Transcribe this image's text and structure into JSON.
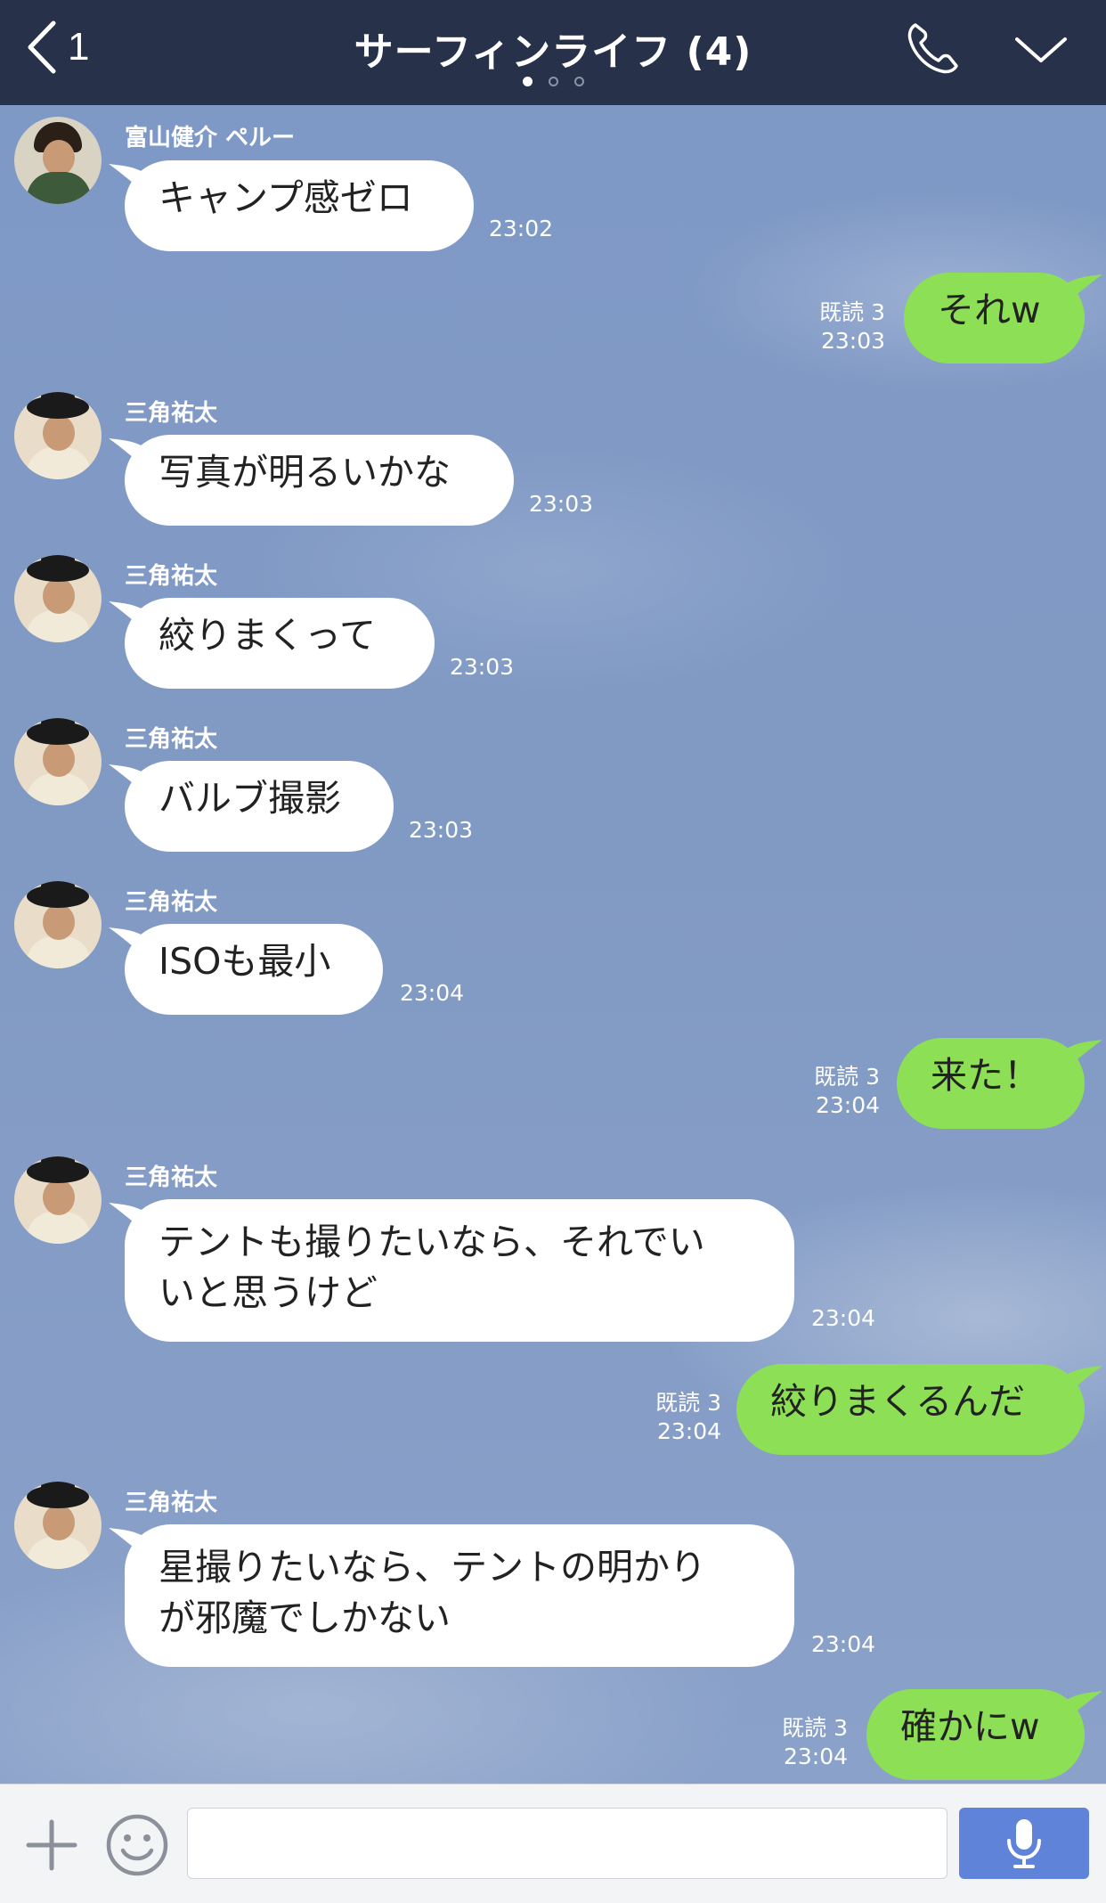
{
  "header": {
    "back_count": "1",
    "title": "サーフィンライフ (4)",
    "page_dots": 3,
    "active_dot": 0
  },
  "messages": [
    {
      "kind": "in",
      "sender": "富山健介 ペルー",
      "text": "キャンプ感ゼロ",
      "time": "23:02"
    },
    {
      "kind": "out",
      "read": "既読 3",
      "text": "それw",
      "time": "23:03"
    },
    {
      "kind": "in",
      "sender": "三角祐太",
      "text": "写真が明るいかな",
      "time": "23:03"
    },
    {
      "kind": "in",
      "sender": "三角祐太",
      "text": "絞りまくって",
      "time": "23:03"
    },
    {
      "kind": "in",
      "sender": "三角祐太",
      "text": "バルブ撮影",
      "time": "23:03"
    },
    {
      "kind": "in",
      "sender": "三角祐太",
      "text": "ISOも最小",
      "time": "23:04"
    },
    {
      "kind": "out",
      "read": "既読 3",
      "text": "来た！",
      "time": "23:04"
    },
    {
      "kind": "in",
      "sender": "三角祐太",
      "text_lines": [
        "テントも撮りたいなら、それでい",
        "いと思うけど"
      ],
      "time": "23:04"
    },
    {
      "kind": "out",
      "read": "既読 3",
      "text": "絞りまくるんだ",
      "time": "23:04"
    },
    {
      "kind": "in",
      "sender": "三角祐太",
      "text_lines": [
        "星撮りたいなら、テントの明かり",
        "が邪魔でしかない"
      ],
      "time": "23:04"
    },
    {
      "kind": "out",
      "read": "既読 3",
      "text": "確かにw",
      "time": "23:04"
    }
  ],
  "input": {
    "value": "",
    "placeholder": ""
  },
  "icons": {
    "back": "chevron-left-icon",
    "call": "phone-icon",
    "menu": "chevron-down-icon",
    "plus": "plus-icon",
    "emoji": "smiley-icon",
    "mic": "microphone-icon"
  },
  "colors": {
    "header_bg": "#28314a",
    "outgoing_bubble": "#8de055",
    "incoming_bubble": "#ffffff",
    "mic_button": "#5f83d8"
  }
}
